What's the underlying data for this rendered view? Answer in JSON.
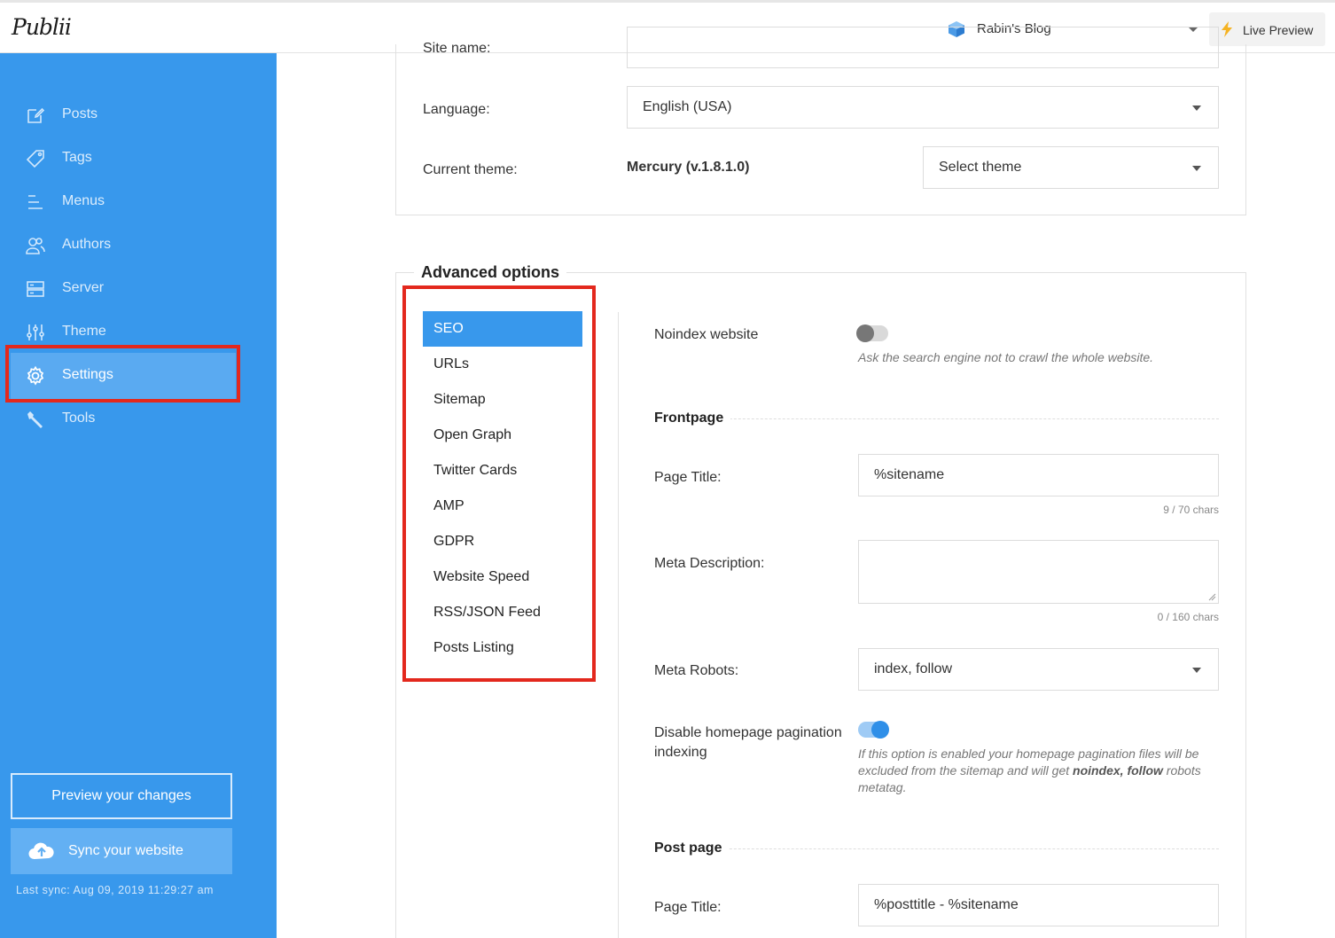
{
  "app": {
    "logo": "Publii"
  },
  "topbar": {
    "site_name": "Rabin's Blog",
    "live_preview": "Live Preview"
  },
  "sidebar": {
    "items": [
      {
        "label": "Posts",
        "icon": "edit-icon"
      },
      {
        "label": "Tags",
        "icon": "tag-icon"
      },
      {
        "label": "Menus",
        "icon": "menu-icon"
      },
      {
        "label": "Authors",
        "icon": "users-icon"
      },
      {
        "label": "Server",
        "icon": "server-icon"
      },
      {
        "label": "Theme",
        "icon": "sliders-icon"
      },
      {
        "label": "Settings",
        "icon": "gear-icon",
        "active": true
      },
      {
        "label": "Tools",
        "icon": "wrench-icon"
      }
    ],
    "preview_button": "Preview your changes",
    "sync_button": "Sync your website",
    "last_sync": "Last sync: Aug 09, 2019 11:29:27 am"
  },
  "basic": {
    "site_name_label": "Site name:",
    "language_label": "Language:",
    "language_value": "English (USA)",
    "theme_label": "Current theme:",
    "theme_value": "Mercury (v.1.8.1.0)",
    "theme_select": "Select theme"
  },
  "advanced": {
    "title": "Advanced options",
    "tabs": [
      "SEO",
      "URLs",
      "Sitemap",
      "Open Graph",
      "Twitter Cards",
      "AMP",
      "GDPR",
      "Website Speed",
      "RSS/JSON Feed",
      "Posts Listing"
    ],
    "active_tab": "SEO",
    "noindex": {
      "label": "Noindex website",
      "hint": "Ask the search engine not to crawl the whole website.",
      "enabled": false
    },
    "frontpage": {
      "title": "Frontpage",
      "page_title_label": "Page Title:",
      "page_title_value": "%sitename",
      "page_title_counter": "9 / 70 chars",
      "meta_description_label": "Meta Description:",
      "meta_description_value": "",
      "meta_description_counter": "0 / 160 chars",
      "meta_robots_label": "Meta Robots:",
      "meta_robots_value": "index, follow",
      "pagination_label": "Disable homepage pagination indexing",
      "pagination_enabled": true,
      "pagination_hint_1": "If this option is enabled your homepage pagination files will be excluded from the sitemap and will get ",
      "pagination_hint_bold": "noindex, follow",
      "pagination_hint_2": " robots metatag."
    },
    "post_page": {
      "title": "Post page",
      "page_title_label": "Page Title:",
      "page_title_value": "%posttitle - %sitename"
    }
  },
  "colors": {
    "sidebar": "#3898ec",
    "accent": "#3898ec",
    "highlight": "#e3281d"
  }
}
